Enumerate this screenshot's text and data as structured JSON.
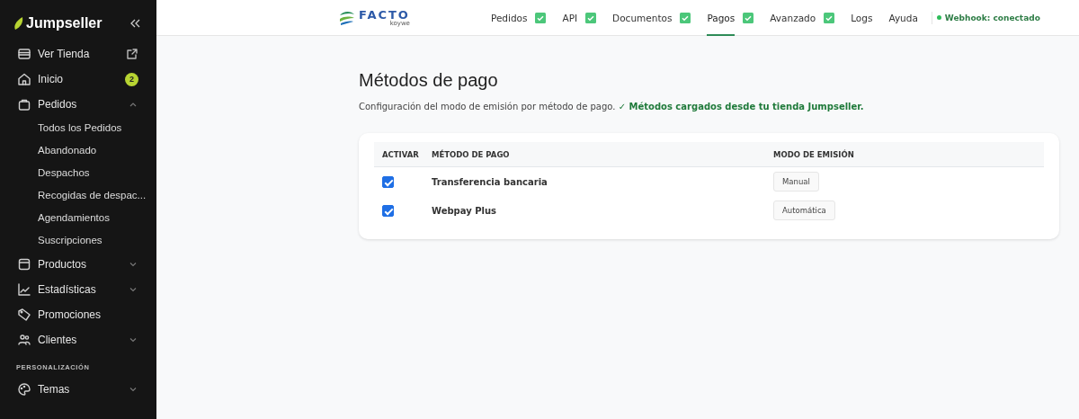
{
  "sidebar": {
    "brand": "Jumpseller",
    "items": [
      {
        "kind": "external",
        "label": "Ver Tienda"
      },
      {
        "kind": "badge",
        "label": "Inicio",
        "badge": "2"
      },
      {
        "kind": "group",
        "label": "Pedidos",
        "expanded": true,
        "children": [
          {
            "label": "Todos los Pedidos"
          },
          {
            "label": "Abandonado"
          },
          {
            "label": "Despachos"
          },
          {
            "label": "Recogidas de despac..."
          },
          {
            "label": "Agendamientos"
          },
          {
            "label": "Suscripciones"
          }
        ]
      },
      {
        "kind": "group",
        "label": "Productos",
        "expanded": false
      },
      {
        "kind": "group",
        "label": "Estadísticas",
        "expanded": false
      },
      {
        "kind": "link",
        "label": "Promociones"
      },
      {
        "kind": "group",
        "label": "Clientes",
        "expanded": false
      },
      {
        "kind": "heading",
        "label": "PERSONALIZACIÓN"
      },
      {
        "kind": "group",
        "label": "Temas",
        "expanded": false
      }
    ]
  },
  "header": {
    "logo": {
      "name": "FACTO",
      "byline": "koywe"
    },
    "tabs": [
      {
        "label": "Pedidos",
        "checked": true,
        "selected": false
      },
      {
        "label": "API",
        "checked": true,
        "selected": false
      },
      {
        "label": "Documentos",
        "checked": true,
        "selected": false
      },
      {
        "label": "Pagos",
        "checked": true,
        "selected": true
      },
      {
        "label": "Avanzado",
        "checked": true,
        "selected": false
      },
      {
        "label": "Logs",
        "checked": false,
        "selected": false
      },
      {
        "label": "Ayuda",
        "checked": false,
        "selected": false
      }
    ],
    "webhook": {
      "label": "Webhook: conectado",
      "connected": true
    }
  },
  "page": {
    "title": "Métodos de pago",
    "description": "Configuración del modo de emisión por método de pago.",
    "notice": "✓ Métodos cargados desde tu tienda Jumpseller."
  },
  "table": {
    "columns": [
      "ACTIVAR",
      "MÉTODO DE PAGO",
      "MODO DE EMISIÓN"
    ],
    "rows": [
      {
        "checked": true,
        "method": "Transferencia bancaria",
        "mode": "Manual"
      },
      {
        "checked": true,
        "method": "Webpay Plus",
        "mode": "Automática"
      }
    ]
  }
}
